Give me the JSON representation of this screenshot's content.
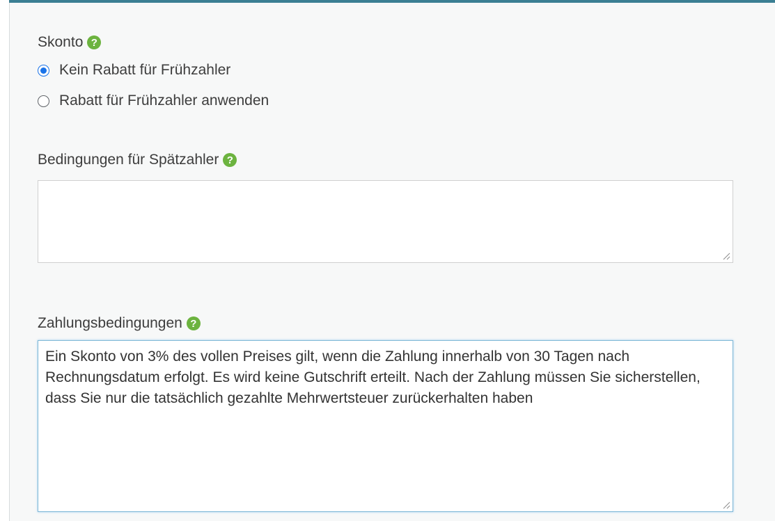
{
  "skonto": {
    "label": "Skonto",
    "help_icon": "help-circle-icon",
    "options": [
      {
        "label": "Kein Rabatt für Frühzahler",
        "checked": true
      },
      {
        "label": "Rabatt für Frühzahler anwenden",
        "checked": false
      }
    ]
  },
  "late_terms": {
    "label": "Bedingungen für Spätzahler",
    "help_icon": "help-circle-icon",
    "value": ""
  },
  "payment_terms": {
    "label": "Zahlungsbedingungen",
    "help_icon": "help-circle-icon",
    "value": "Ein Skonto von 3% des vollen Preises gilt, wenn die Zahlung innerhalb von 30 Tagen nach Rechnungsdatum erfolgt. Es wird keine Gutschrift erteilt. Nach der Zahlung müssen Sie sicherstellen, dass Sie nur die tatsächlich gezahlte Mehrwertsteuer zurückerhalten haben"
  },
  "colors": {
    "accent_bar": "#3b7f93",
    "help_icon": "#6cb33f",
    "radio_checked": "#1a73e8",
    "focus_border": "#7fb8d6"
  }
}
